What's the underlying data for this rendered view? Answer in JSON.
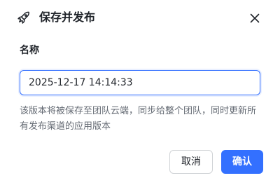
{
  "dialog": {
    "title": "保存并发布",
    "title_icon": "rocket-icon",
    "close_icon": "close-icon"
  },
  "form": {
    "name_label": "名称",
    "name_value": "2025-12-17 14:14:33",
    "description": "该版本将被保存至团队云端，同步给整个团队，同时更新所有发布渠道的应用版本"
  },
  "footer": {
    "cancel_label": "取消",
    "confirm_label": "确认"
  },
  "colors": {
    "accent": "#3370ff",
    "text_primary": "#1f2329",
    "text_secondary": "#646a73",
    "border": "#d0d3d6"
  }
}
